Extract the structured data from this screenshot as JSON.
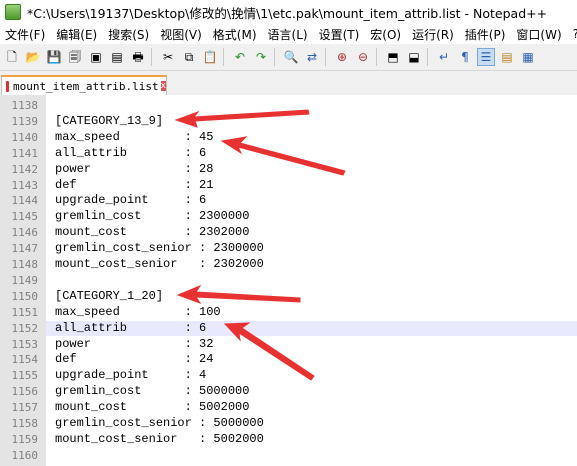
{
  "window": {
    "title": "*C:\\Users\\19137\\Desktop\\修改的\\挽情\\1\\etc.pak\\mount_item_attrib.list - Notepad++"
  },
  "menu": [
    "文件(F)",
    "编辑(E)",
    "搜索(S)",
    "视图(V)",
    "格式(M)",
    "语言(L)",
    "设置(T)",
    "宏(O)",
    "运行(R)",
    "插件(P)",
    "窗口(W)",
    "?"
  ],
  "toolbar": {
    "icons": [
      "new-file-icon",
      "open-file-icon",
      "save-icon",
      "save-all-icon",
      "close-icon",
      "close-all-icon",
      "print-icon",
      "cut-icon",
      "copy-icon",
      "paste-icon",
      "undo-icon",
      "redo-icon",
      "find-icon",
      "replace-icon",
      "zoom-in-icon",
      "zoom-out-icon",
      "sync-v-icon",
      "sync-h-icon",
      "wrap-icon",
      "show-all-icon",
      "indent-guide-icon",
      "macro-record-icon",
      "macro-stop-icon"
    ]
  },
  "tab": {
    "label": "mount_item_attrib.list",
    "close": "x"
  },
  "editor": {
    "lines": [
      {
        "n": "1138",
        "text": ""
      },
      {
        "n": "1139",
        "text": "[CATEGORY_13_9]"
      },
      {
        "n": "1140",
        "text": "max_speed         : 45"
      },
      {
        "n": "1141",
        "text": "all_attrib        : 6"
      },
      {
        "n": "1142",
        "text": "power             : 28"
      },
      {
        "n": "1143",
        "text": "def               : 21"
      },
      {
        "n": "1144",
        "text": "upgrade_point     : 6"
      },
      {
        "n": "1145",
        "text": "gremlin_cost      : 2300000"
      },
      {
        "n": "1146",
        "text": "mount_cost        : 2302000"
      },
      {
        "n": "1147",
        "text": "gremlin_cost_senior : 2300000"
      },
      {
        "n": "1148",
        "text": "mount_cost_senior   : 2302000"
      },
      {
        "n": "1149",
        "text": ""
      },
      {
        "n": "1150",
        "text": "[CATEGORY_1_20]"
      },
      {
        "n": "1151",
        "text": "max_speed         : 100"
      },
      {
        "n": "1152",
        "text": "all_attrib        : 6"
      },
      {
        "n": "1153",
        "text": "power             : 32"
      },
      {
        "n": "1154",
        "text": "def               : 24"
      },
      {
        "n": "1155",
        "text": "upgrade_point     : 4"
      },
      {
        "n": "1156",
        "text": "gremlin_cost      : 5000000"
      },
      {
        "n": "1157",
        "text": "mount_cost        : 5002000"
      },
      {
        "n": "1158",
        "text": "gremlin_cost_senior : 5000000"
      },
      {
        "n": "1159",
        "text": "mount_cost_senior   : 5002000"
      },
      {
        "n": "1160",
        "text": ""
      }
    ],
    "current_line": "1152"
  },
  "colors": {
    "annotation_arrow": "#e83232",
    "current_line_bg": "#e8e8ff",
    "gutter_bg": "#e4e4e4"
  }
}
